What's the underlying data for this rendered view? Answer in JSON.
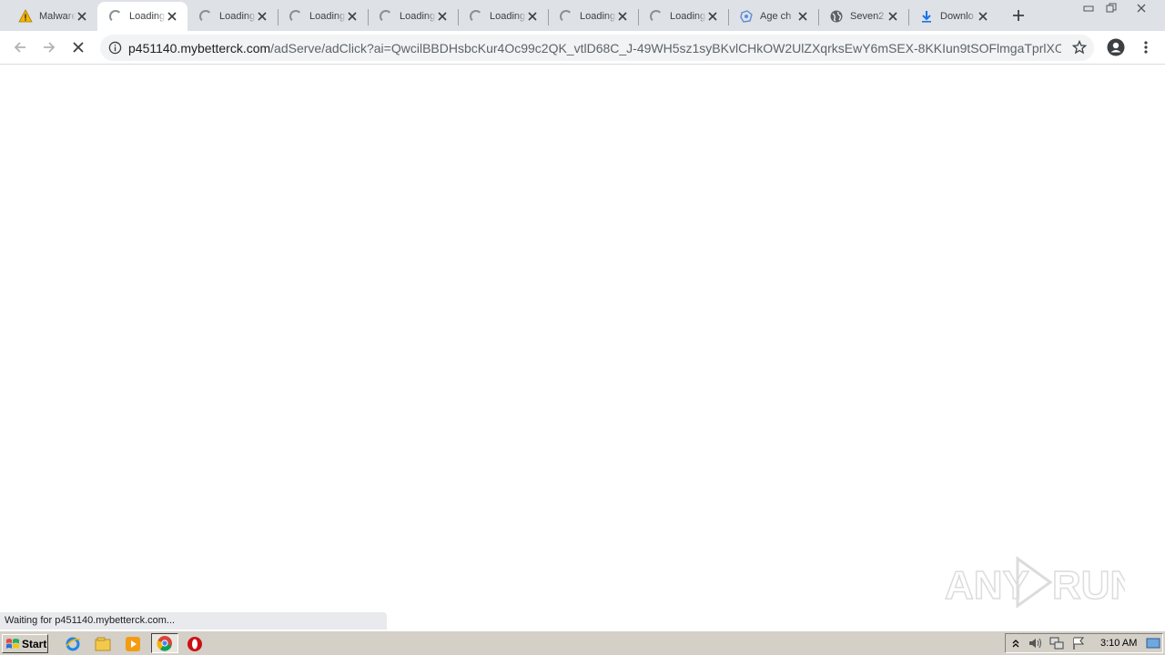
{
  "browser": {
    "tabs": [
      {
        "title": "Malware",
        "icon": "warning-icon",
        "active": false
      },
      {
        "title": "Loading...",
        "icon": "loading-spinner-icon",
        "active": true
      },
      {
        "title": "Loading...",
        "icon": "loading-spinner-icon",
        "active": false
      },
      {
        "title": "Loading...",
        "icon": "loading-spinner-icon",
        "active": false
      },
      {
        "title": "Loading...",
        "icon": "loading-spinner-icon",
        "active": false
      },
      {
        "title": "Loading...",
        "icon": "loading-spinner-icon",
        "active": false
      },
      {
        "title": "Loading...",
        "icon": "loading-spinner-icon",
        "active": false
      },
      {
        "title": "Loading...",
        "icon": "loading-spinner-icon",
        "active": false
      },
      {
        "title": "Age ch",
        "icon": "puzzle-icon",
        "active": false
      },
      {
        "title": "Seven2",
        "icon": "globe-icon",
        "active": false
      },
      {
        "title": "Downlo",
        "icon": "download-icon",
        "active": false
      }
    ],
    "address": {
      "domain": "p451140.mybetterck.com",
      "path": "/adServe/adClick?ai=QwcilBBDHsbcKur4Oc99c2QK_vtlD68C_J-49WH5sz1syBKvlCHkOW2UlZXqrksEwY6mSEX-8KKIun9tSOFlmgaTprlXOMa..."
    },
    "status_text": "Waiting for p451140.mybetterck.com..."
  },
  "watermark": {
    "text": "ANY RUN"
  },
  "taskbar": {
    "start_label": "Start",
    "clock": "3:10 AM"
  },
  "colors": {
    "tabstrip": "#dee1e6",
    "omnibox": "#f1f3f4",
    "taskbar": "#d4d0c8"
  }
}
